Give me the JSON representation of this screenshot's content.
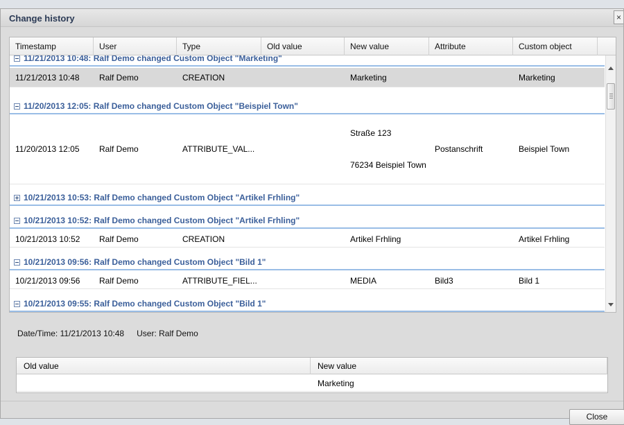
{
  "dialog": {
    "title": "Change history",
    "close_symbol": "×"
  },
  "grid": {
    "columns": [
      "Timestamp",
      "User",
      "Type",
      "Old value",
      "New value",
      "Attribute",
      "Custom object"
    ],
    "groups": [
      {
        "label": "11/21/2013 10:48: Ralf Demo changed Custom Object \"Marketing\"",
        "expanded": true,
        "rows": [
          {
            "timestamp": "11/21/2013 10:48",
            "user": "Ralf Demo",
            "type": "CREATION",
            "old_value": "",
            "new_value": "Marketing",
            "attribute": "",
            "custom_object": "Marketing",
            "selected": true
          }
        ]
      },
      {
        "label": "11/20/2013 12:05: Ralf Demo changed Custom Object \"Beispiel Town\"",
        "expanded": true,
        "rows": [
          {
            "timestamp": "11/20/2013 12:05",
            "user": "Ralf Demo",
            "type": "ATTRIBUTE_VAL...",
            "old_value": "",
            "new_value_line1": "Straße 123",
            "new_value_line2": "76234 Beispiel Town",
            "attribute": "Postanschrift",
            "custom_object": "Beispiel Town"
          }
        ]
      },
      {
        "label": "10/21/2013 10:53: Ralf Demo changed Custom Object \"Artikel Frhling\"",
        "expanded": false,
        "rows": []
      },
      {
        "label": "10/21/2013 10:52: Ralf Demo changed Custom Object \"Artikel Frhling\"",
        "expanded": true,
        "rows": [
          {
            "timestamp": "10/21/2013 10:52",
            "user": "Ralf Demo",
            "type": "CREATION",
            "old_value": "",
            "new_value": "Artikel Frhling",
            "attribute": "",
            "custom_object": "Artikel Frhling"
          }
        ]
      },
      {
        "label": "10/21/2013 09:56: Ralf Demo changed Custom Object \"Bild 1\"",
        "expanded": true,
        "rows": [
          {
            "timestamp": "10/21/2013 09:56",
            "user": "Ralf Demo",
            "type": "ATTRIBUTE_FIEL...",
            "old_value": "",
            "new_value": "MEDIA",
            "attribute": "Bild3",
            "custom_object": "Bild 1"
          }
        ]
      },
      {
        "label": "10/21/2013 09:55: Ralf Demo changed Custom Object \"Bild 1\"",
        "expanded": true,
        "rows": []
      }
    ]
  },
  "details": {
    "datetime": "Date/Time: 11/21/2013 10:48",
    "user": "User: Ralf Demo",
    "columns": [
      "Old value",
      "New value"
    ],
    "row": {
      "old_value": "",
      "new_value": "Marketing"
    }
  },
  "footer": {
    "close_label": "Close"
  },
  "icons": {
    "expanded": "minus-box-icon",
    "collapsed": "plus-box-icon",
    "scroll_up": "arrow-up-icon",
    "scroll_down": "arrow-down-icon"
  },
  "colors": {
    "group_text": "#3b5f9a",
    "group_underline": "#99bde6",
    "selected_row": "#d9d9d9"
  }
}
